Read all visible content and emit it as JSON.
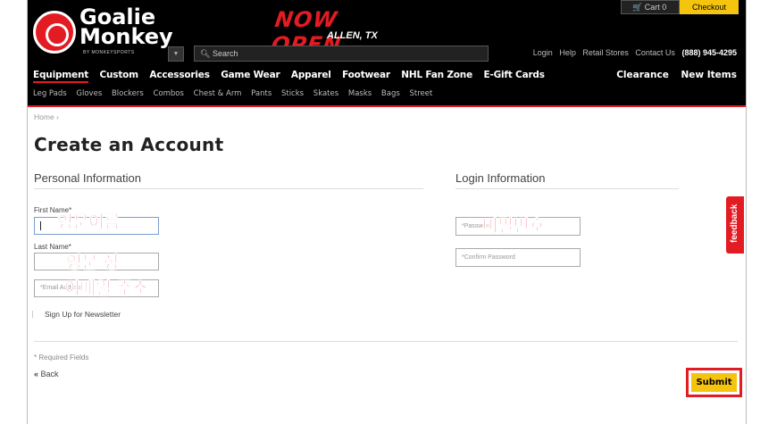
{
  "header": {
    "logo_line1": "Goalie",
    "logo_line2": "Monkey",
    "logo_sub": "BY MONKEYSPORTS",
    "banner_main": "NOW OPEN",
    "banner_sub": "ALLEN, TX",
    "cart_label": "Cart 0",
    "checkout_label": "Checkout",
    "search_label": "Search",
    "top_links": [
      "Login",
      "Help",
      "Retail Stores",
      "Contact Us"
    ],
    "phone": "(888) 945-4295",
    "main_nav": [
      "Equipment",
      "Custom",
      "Accessories",
      "Game Wear",
      "Apparel",
      "Footwear",
      "NHL Fan Zone",
      "E-Gift Cards"
    ],
    "right_nav": [
      "Clearance",
      "New Items"
    ],
    "sub_nav": [
      "Leg Pads",
      "Gloves",
      "Blockers",
      "Combos",
      "Chest & Arm",
      "Pants",
      "Sticks",
      "Skates",
      "Masks",
      "Bags",
      "Street"
    ],
    "accent_color": "#e31b23",
    "button_color": "#f4c40f"
  },
  "breadcrumb": "Home ›",
  "page_title": "Create an Account",
  "personal": {
    "title": "Personal Information",
    "first_name_label": "First Name*",
    "last_name_label": "Last Name*",
    "email_placeholder": "*Email Address",
    "newsletter_label": "Sign Up for Newsletter"
  },
  "login": {
    "title": "Login Information",
    "password_placeholder": "*Password",
    "confirm_placeholder": "*Confirm Password"
  },
  "annotations": {
    "first_name": "영문이름",
    "last_name": "영문 성",
    "email": "이메일 주소",
    "password": "비밀번호"
  },
  "feedback_label": "feedback",
  "required_note": "* Required Fields",
  "back_label": "Back",
  "submit_label": "Submit"
}
